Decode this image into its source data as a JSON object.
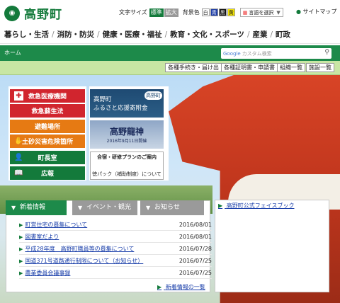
{
  "header": {
    "site_name": "高野町",
    "text_size_label": "文字サイズ",
    "text_size_standard": "標準",
    "text_size_large": "拡大",
    "bg_color_label": "背景色",
    "bg_options": [
      "白",
      "青",
      "黒",
      "黄"
    ],
    "language_select": "言語を選択",
    "sitemap": "サイトマップ"
  },
  "gnav": {
    "items": [
      "暮らし・生活",
      "消防・防災",
      "健康・医療・福祉",
      "教育・文化・スポーツ",
      "産業",
      "町政"
    ]
  },
  "breadcrumb": {
    "home": "ホーム"
  },
  "search": {
    "placeholder": "カスタム検索",
    "brand": "Google"
  },
  "subnav": {
    "items": [
      "各種手続き・届け出",
      "各種証明書・申請書",
      "組織一覧",
      "施設一覧"
    ]
  },
  "emergency_menu": {
    "items": [
      {
        "label": "救急医療機関",
        "color": "#d1252e",
        "icon": "cross-icon"
      },
      {
        "label": "救急蘇生法",
        "color": "#d1252e",
        "icon": ""
      },
      {
        "label": "避難場所",
        "color": "#e67a13",
        "icon": ""
      },
      {
        "label": "土砂災害危険箇所",
        "color": "#e67a13",
        "icon": "hand-icon"
      },
      {
        "label": "町長室",
        "color": "#137a3b",
        "icon": "person-icon"
      },
      {
        "label": "広報",
        "color": "#137a3b",
        "icon": "book-icon"
      }
    ]
  },
  "banners": {
    "furusato_line1": "高野町",
    "furusato_line2": "ふるさと応援寄附金",
    "furusato_badge": "高野町",
    "marathon_title": "高野龍神",
    "marathon_date": "2016年9月11日開催",
    "camp_line1": "合宿・研修プランのご案内",
    "camp_line2": "徳パック（補助制度）について"
  },
  "news": {
    "tabs": [
      "新着情報",
      "イベント・観光",
      "お知らせ"
    ],
    "items": [
      {
        "title": "町営住宅の募集について",
        "date": "2016/08/01"
      },
      {
        "title": "図書室だより",
        "date": "2016/08/01"
      },
      {
        "title": "平成28年度　高野町職員等の募集について",
        "date": "2016/07/28"
      },
      {
        "title": "国道371号道路通行制限について（お知らせ）",
        "date": "2016/07/25"
      },
      {
        "title": "農業委員会議事録",
        "date": "2016/07/25"
      }
    ],
    "list_link": "新着情報の一覧"
  },
  "facebook": {
    "link": "高野町公式フェイスブック"
  },
  "colors": {
    "brand_green": "#137a3b",
    "subbar_green": "#c8e6a4",
    "emergency_red": "#d1252e",
    "orange": "#e67a13"
  }
}
